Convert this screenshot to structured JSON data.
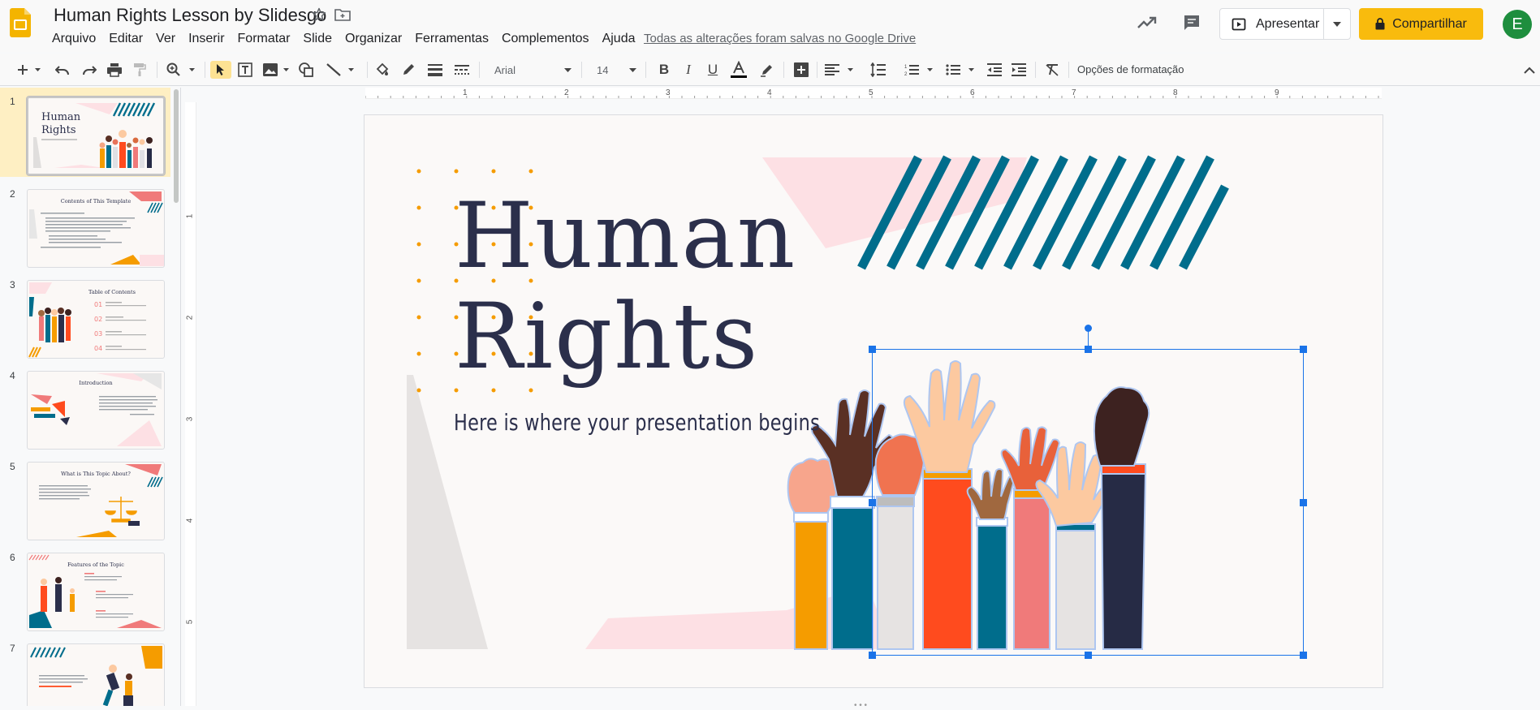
{
  "header": {
    "title": "Human Rights Lesson by Slidesgo",
    "menu": [
      "Arquivo",
      "Editar",
      "Ver",
      "Inserir",
      "Formatar",
      "Slide",
      "Organizar",
      "Ferramentas",
      "Complementos",
      "Ajuda"
    ],
    "save_status": "Todas as alterações foram salvas no Google Drive",
    "present_label": "Apresentar",
    "share_label": "Compartilhar",
    "avatar_initial": "E"
  },
  "toolbar": {
    "font": "Arial",
    "font_size": "14",
    "format_options": "Opções de formatação"
  },
  "ruler": {
    "horizontal": [
      "1",
      "2",
      "3",
      "4",
      "5",
      "6",
      "7",
      "8",
      "9"
    ],
    "vertical": [
      "1",
      "2",
      "3",
      "4",
      "5"
    ]
  },
  "slides": [
    {
      "num": "1",
      "title": "Human Rights",
      "subtitle": "Here is where your presentation begins"
    },
    {
      "num": "2",
      "title": "Contents of This Template"
    },
    {
      "num": "3",
      "title": "Table of Contents",
      "items": [
        "01",
        "02",
        "03",
        "04"
      ]
    },
    {
      "num": "4",
      "title": "Introduction"
    },
    {
      "num": "5",
      "title": "What is This Topic About?"
    },
    {
      "num": "6",
      "title": "Features of the Topic"
    },
    {
      "num": "7",
      "title": ""
    }
  ],
  "slide": {
    "title_line1": "Human",
    "title_line2": "Rights",
    "subtitle": "Here is where your presentation begins"
  },
  "colors": {
    "accent": "#f9bb0d",
    "navy": "#2b2f4b",
    "teal": "#006d8c",
    "pink": "#fde0e4",
    "orange": "#f59c00",
    "red": "#ff4b1e",
    "selection": "#1a73e8"
  }
}
